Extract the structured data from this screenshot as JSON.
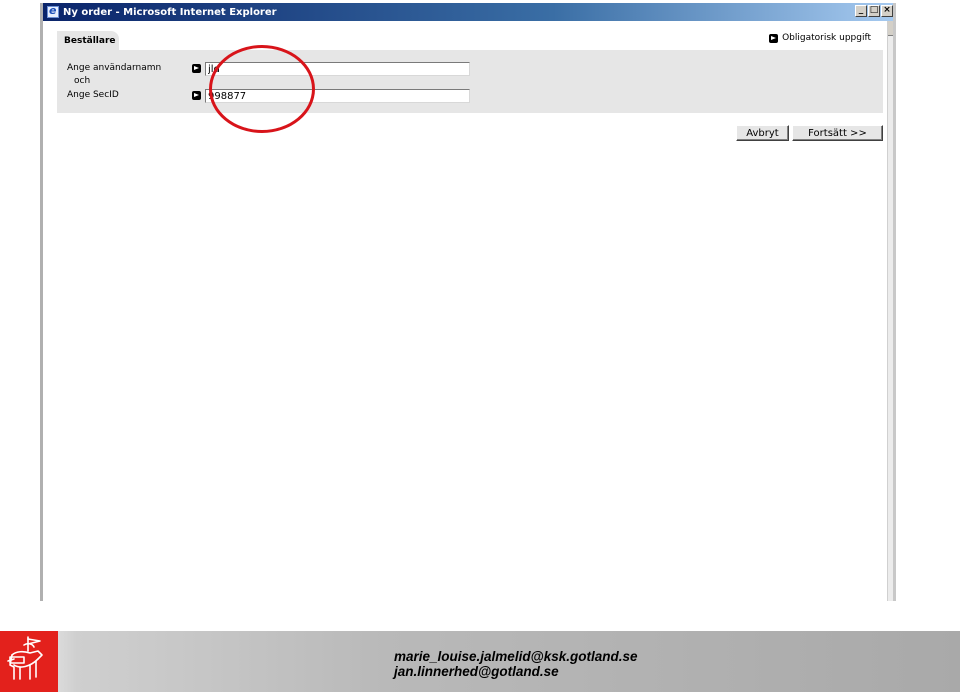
{
  "window": {
    "title": "Ny order - Microsoft Internet Explorer",
    "buttons": {
      "minimize": "_",
      "maximize": "□",
      "close": "×"
    }
  },
  "form": {
    "tab_label": "Beställare",
    "required_note": "Obligatorisk uppgift",
    "username_label": "Ange användarnamn",
    "och_label": "och",
    "secid_label": "Ange SecID",
    "username_value": "jld",
    "secid_value": "998877"
  },
  "actions": {
    "cancel_label": "Avbryt",
    "continue_label": "Fortsätt >>"
  },
  "footer": {
    "email_1": "marie_louise.jalmelid@ksk.gotland.se",
    "email_2": "jan.linnerhed@gotland.se"
  },
  "colors": {
    "annotation": "#d8141a",
    "logo_background": "#e3211c",
    "titlebar": "#0a246a",
    "panel": "#e6e6e6"
  },
  "icons": [
    "ie-icon",
    "arrow-icon",
    "goat-logo-icon"
  ]
}
